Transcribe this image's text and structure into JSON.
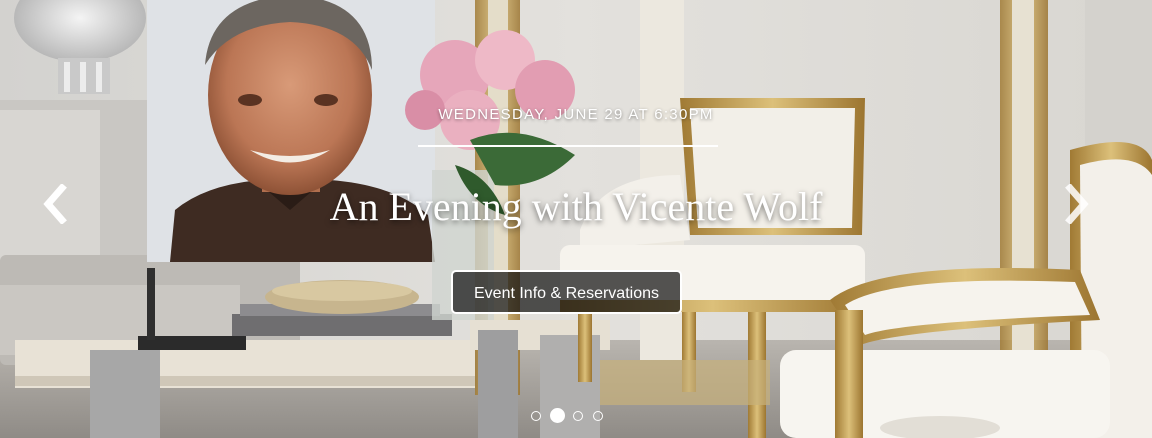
{
  "slide": {
    "date": "WEDNESDAY, JUNE 29 AT 6:30PM",
    "title": "An Evening with Vicente Wolf",
    "cta_label": "Event Info & Reservations"
  },
  "navigation": {
    "prev_icon": "chevron-left-icon",
    "next_icon": "chevron-right-icon"
  },
  "pagination": {
    "count": 4,
    "active_index": 1
  },
  "colors": {
    "text": "#ffffff",
    "button_bg": "rgba(20,20,20,0.72)",
    "gilt": "#c8a24e"
  }
}
